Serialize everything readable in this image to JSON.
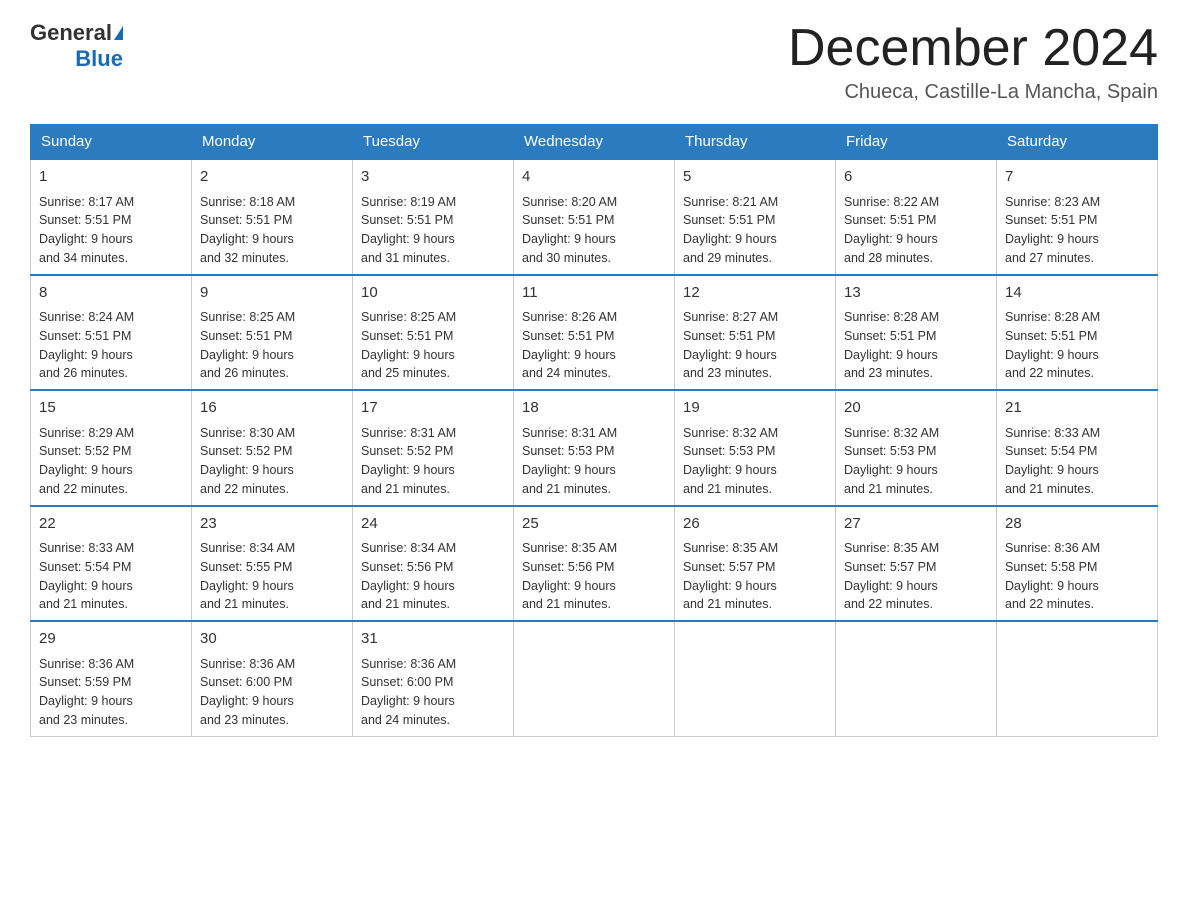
{
  "logo": {
    "general": "General",
    "blue": "Blue"
  },
  "header": {
    "month": "December 2024",
    "location": "Chueca, Castille-La Mancha, Spain"
  },
  "weekdays": [
    "Sunday",
    "Monday",
    "Tuesday",
    "Wednesday",
    "Thursday",
    "Friday",
    "Saturday"
  ],
  "weeks": [
    [
      {
        "day": "1",
        "sunrise": "8:17 AM",
        "sunset": "5:51 PM",
        "daylight": "9 hours and 34 minutes."
      },
      {
        "day": "2",
        "sunrise": "8:18 AM",
        "sunset": "5:51 PM",
        "daylight": "9 hours and 32 minutes."
      },
      {
        "day": "3",
        "sunrise": "8:19 AM",
        "sunset": "5:51 PM",
        "daylight": "9 hours and 31 minutes."
      },
      {
        "day": "4",
        "sunrise": "8:20 AM",
        "sunset": "5:51 PM",
        "daylight": "9 hours and 30 minutes."
      },
      {
        "day": "5",
        "sunrise": "8:21 AM",
        "sunset": "5:51 PM",
        "daylight": "9 hours and 29 minutes."
      },
      {
        "day": "6",
        "sunrise": "8:22 AM",
        "sunset": "5:51 PM",
        "daylight": "9 hours and 28 minutes."
      },
      {
        "day": "7",
        "sunrise": "8:23 AM",
        "sunset": "5:51 PM",
        "daylight": "9 hours and 27 minutes."
      }
    ],
    [
      {
        "day": "8",
        "sunrise": "8:24 AM",
        "sunset": "5:51 PM",
        "daylight": "9 hours and 26 minutes."
      },
      {
        "day": "9",
        "sunrise": "8:25 AM",
        "sunset": "5:51 PM",
        "daylight": "9 hours and 26 minutes."
      },
      {
        "day": "10",
        "sunrise": "8:25 AM",
        "sunset": "5:51 PM",
        "daylight": "9 hours and 25 minutes."
      },
      {
        "day": "11",
        "sunrise": "8:26 AM",
        "sunset": "5:51 PM",
        "daylight": "9 hours and 24 minutes."
      },
      {
        "day": "12",
        "sunrise": "8:27 AM",
        "sunset": "5:51 PM",
        "daylight": "9 hours and 23 minutes."
      },
      {
        "day": "13",
        "sunrise": "8:28 AM",
        "sunset": "5:51 PM",
        "daylight": "9 hours and 23 minutes."
      },
      {
        "day": "14",
        "sunrise": "8:28 AM",
        "sunset": "5:51 PM",
        "daylight": "9 hours and 22 minutes."
      }
    ],
    [
      {
        "day": "15",
        "sunrise": "8:29 AM",
        "sunset": "5:52 PM",
        "daylight": "9 hours and 22 minutes."
      },
      {
        "day": "16",
        "sunrise": "8:30 AM",
        "sunset": "5:52 PM",
        "daylight": "9 hours and 22 minutes."
      },
      {
        "day": "17",
        "sunrise": "8:31 AM",
        "sunset": "5:52 PM",
        "daylight": "9 hours and 21 minutes."
      },
      {
        "day": "18",
        "sunrise": "8:31 AM",
        "sunset": "5:53 PM",
        "daylight": "9 hours and 21 minutes."
      },
      {
        "day": "19",
        "sunrise": "8:32 AM",
        "sunset": "5:53 PM",
        "daylight": "9 hours and 21 minutes."
      },
      {
        "day": "20",
        "sunrise": "8:32 AM",
        "sunset": "5:53 PM",
        "daylight": "9 hours and 21 minutes."
      },
      {
        "day": "21",
        "sunrise": "8:33 AM",
        "sunset": "5:54 PM",
        "daylight": "9 hours and 21 minutes."
      }
    ],
    [
      {
        "day": "22",
        "sunrise": "8:33 AM",
        "sunset": "5:54 PM",
        "daylight": "9 hours and 21 minutes."
      },
      {
        "day": "23",
        "sunrise": "8:34 AM",
        "sunset": "5:55 PM",
        "daylight": "9 hours and 21 minutes."
      },
      {
        "day": "24",
        "sunrise": "8:34 AM",
        "sunset": "5:56 PM",
        "daylight": "9 hours and 21 minutes."
      },
      {
        "day": "25",
        "sunrise": "8:35 AM",
        "sunset": "5:56 PM",
        "daylight": "9 hours and 21 minutes."
      },
      {
        "day": "26",
        "sunrise": "8:35 AM",
        "sunset": "5:57 PM",
        "daylight": "9 hours and 21 minutes."
      },
      {
        "day": "27",
        "sunrise": "8:35 AM",
        "sunset": "5:57 PM",
        "daylight": "9 hours and 22 minutes."
      },
      {
        "day": "28",
        "sunrise": "8:36 AM",
        "sunset": "5:58 PM",
        "daylight": "9 hours and 22 minutes."
      }
    ],
    [
      {
        "day": "29",
        "sunrise": "8:36 AM",
        "sunset": "5:59 PM",
        "daylight": "9 hours and 23 minutes."
      },
      {
        "day": "30",
        "sunrise": "8:36 AM",
        "sunset": "6:00 PM",
        "daylight": "9 hours and 23 minutes."
      },
      {
        "day": "31",
        "sunrise": "8:36 AM",
        "sunset": "6:00 PM",
        "daylight": "9 hours and 24 minutes."
      },
      null,
      null,
      null,
      null
    ]
  ],
  "labels": {
    "sunrise": "Sunrise:",
    "sunset": "Sunset:",
    "daylight": "Daylight:"
  }
}
